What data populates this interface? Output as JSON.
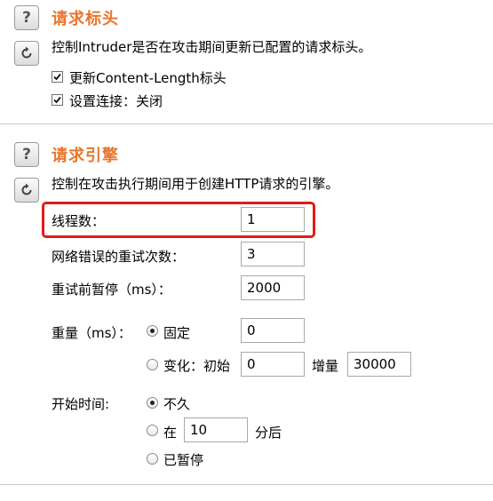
{
  "request_headers": {
    "title": "请求标头",
    "help_glyph": "?",
    "description": "控制Intruder是否在攻击期间更新已配置的请求标头。",
    "options": [
      {
        "label": "更新Content-Length标头",
        "checked": true
      },
      {
        "label": "设置连接：关闭",
        "checked": true
      }
    ]
  },
  "request_engine": {
    "title": "请求引擎",
    "help_glyph": "?",
    "description": "控制在攻击执行期间用于创建HTTP请求的引擎。",
    "threads": {
      "label": "线程数：",
      "value": "1"
    },
    "retries": {
      "label": "网络错误的重试次数：",
      "value": "3"
    },
    "pause": {
      "label": "重试前暂停（ms）：",
      "value": "2000"
    },
    "throttle": {
      "label": "重量（ms）：",
      "fixed_label": "固定",
      "fixed_value": "0",
      "fixed_selected": true,
      "variable_label": "变化：初始",
      "variable_start": "0",
      "increment_label": "增量",
      "increment_value": "30000"
    },
    "start_time": {
      "label": "开始时间:",
      "immediately_label": "不久",
      "immediately_selected": true,
      "in_label": "在",
      "in_value": "10",
      "minutes_label": "分后",
      "paused_label": "已暂停"
    }
  },
  "accent_color": "#e8762d",
  "highlight_color": "#e21b1b",
  "icons": [
    "help-icon",
    "restore-defaults-icon",
    "checkbox-checked-icon"
  ]
}
